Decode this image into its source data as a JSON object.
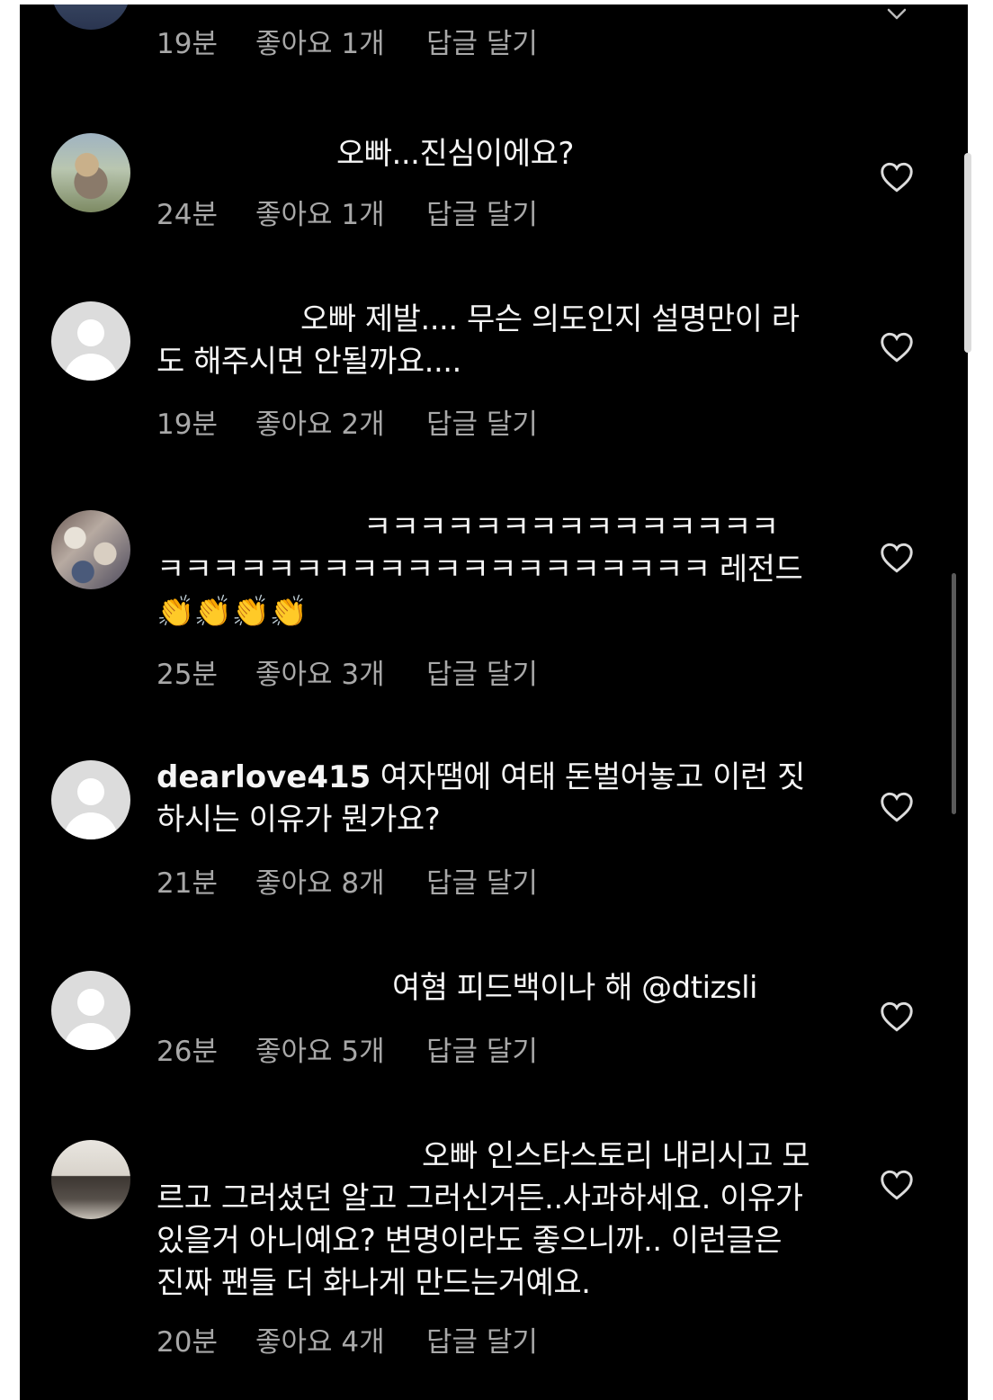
{
  "colors": {
    "background": "#000000",
    "text": "#f5f5f5",
    "meta": "#a8a8a8",
    "avatar_default": "#dcdcdc"
  },
  "top_comment": {
    "time": "19분",
    "likes": "좋아요 1개",
    "reply": "답글 달기"
  },
  "comments": [
    {
      "avatar": "photo-avatar",
      "username": "",
      "text": "오빠...진심이에요?",
      "time": "24분",
      "likes": "좋아요 1개",
      "reply": "답글 달기",
      "icon": "heart-icon"
    },
    {
      "avatar": "default-avatar",
      "username": "",
      "text": "오빠 제발.... 무슨 의도인지 설명만이 라도 해주시면 안될까요....",
      "time": "19분",
      "likes": "좋아요 2개",
      "reply": "답글 달기",
      "icon": "heart-icon"
    },
    {
      "avatar": "photo-avatar",
      "username": "",
      "text": "ㅋㅋㅋㅋㅋㅋㅋㅋㅋㅋㅋㅋㅋㅋㅋㅋㅋㅋㅋㅋㅋㅋㅋㅋㅋㅋㅋㅋㅋㅋㅋㅋㅋㅋㅋ 레전드👏👏👏👏",
      "time": "25분",
      "likes": "좋아요 3개",
      "reply": "답글 달기",
      "icon": "heart-icon"
    },
    {
      "avatar": "default-avatar",
      "username": "dearlove415",
      "text": "여자땜에 여태 돈벌어놓고 이런 짓 하시는 이유가 뭔가요?",
      "time": "21분",
      "likes": "좋아요 8개",
      "reply": "답글 달기",
      "icon": "heart-icon"
    },
    {
      "avatar": "default-avatar",
      "username": "",
      "text": "여혐 피드백이나 해 @dtizsli",
      "time": "26분",
      "likes": "좋아요 5개",
      "reply": "답글 달기",
      "icon": "heart-icon"
    },
    {
      "avatar": "photo-avatar",
      "username": "",
      "text": "오빠 인스타스토리 내리시고 모르고 그러셨던 알고 그러신거든..사과하세요. 이유가 있을거 아니예요? 변명이라도 좋으니까.. 이런글은 진짜 팬들 더 화나게 만드는거예요.",
      "time": "20분",
      "likes": "좋아요 4개",
      "reply": "답글 달기",
      "icon": "heart-icon"
    }
  ]
}
